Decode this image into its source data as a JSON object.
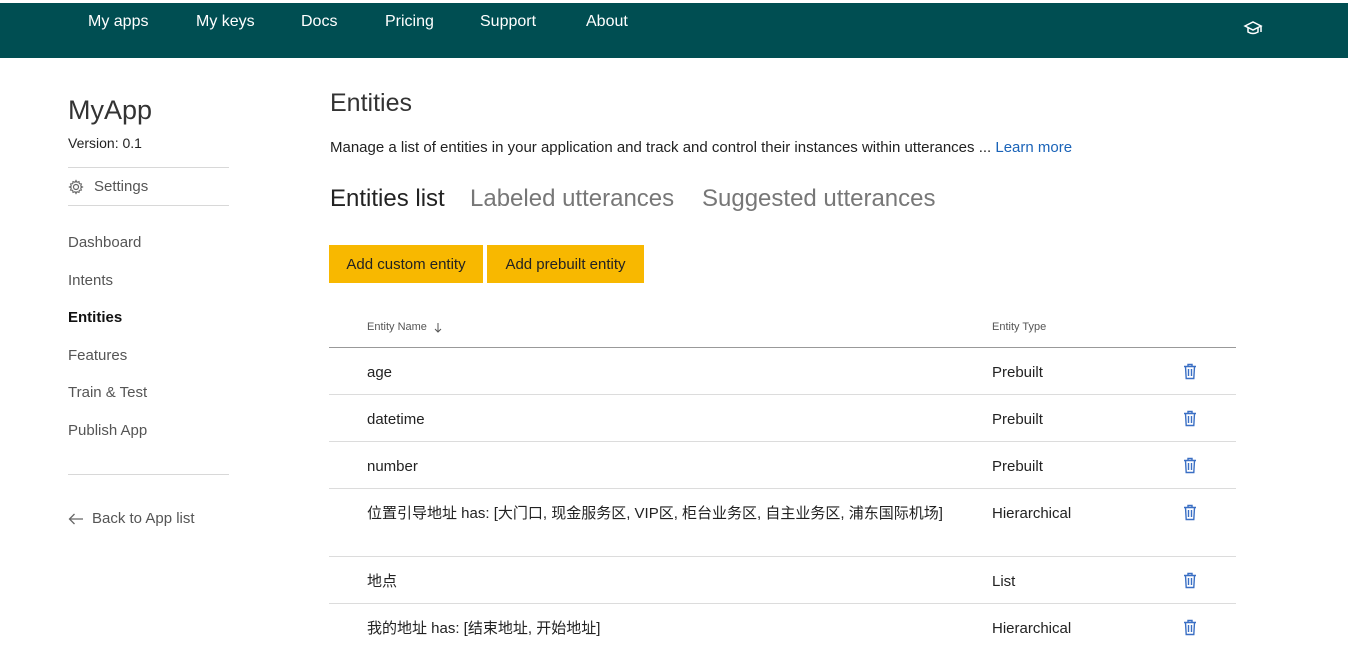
{
  "nav": {
    "items": [
      "My apps",
      "My keys",
      "Docs",
      "Pricing",
      "Support",
      "About"
    ],
    "icon": "graduation-cap-icon"
  },
  "sidebar": {
    "app_name": "MyApp",
    "version": "Version:  0.1",
    "settings_label": "Settings",
    "links": [
      "Dashboard",
      "Intents",
      "Entities",
      "Features",
      "Train & Test",
      "Publish App"
    ],
    "active": "Entities",
    "back_label": "Back to App list"
  },
  "main": {
    "title": "Entities",
    "description": "Manage a list of entities in your application and track and control their instances within utterances ... ",
    "learn_more": "Learn more",
    "tabs": [
      "Entities list",
      "Labeled utterances",
      "Suggested utterances"
    ],
    "active_tab": "Entities list",
    "buttons": {
      "add_custom": "Add custom entity",
      "add_prebuilt": "Add prebuilt entity"
    },
    "table": {
      "col_name": "Entity Name",
      "col_name_sort_icon": "arrow-down-icon",
      "col_type": "Entity Type",
      "rows": [
        {
          "name": "age",
          "type": "Prebuilt"
        },
        {
          "name": "datetime",
          "type": "Prebuilt"
        },
        {
          "name": "number",
          "type": "Prebuilt"
        },
        {
          "name": "位置引导地址 has: [大门口, 现金服务区, VIP区, 柜台业务区, 自主业务区, 浦东国际机场]",
          "type": "Hierarchical"
        },
        {
          "name": "地点",
          "type": "List"
        },
        {
          "name": "我的地址 has: [结束地址, 开始地址]",
          "type": "Hierarchical"
        }
      ]
    }
  },
  "colors": {
    "topbar": "#004e52",
    "button": "#f8b800",
    "link": "#1a63b8",
    "trash_icon": "#3a6fc4"
  }
}
